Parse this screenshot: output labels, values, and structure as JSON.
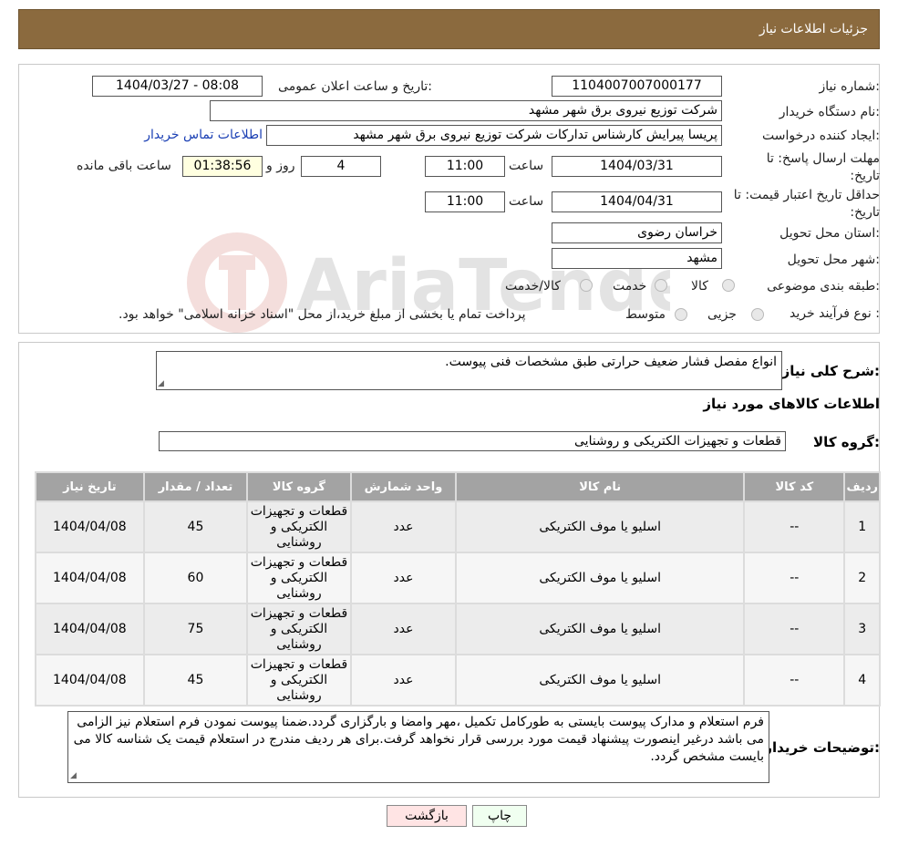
{
  "header": {
    "title": "جزئیات اطلاعات نیاز"
  },
  "form": {
    "need_number_label": "شماره نیاز:",
    "need_number": "1104007007000177",
    "announce_label": "تاریخ و ساعت اعلان عمومی:",
    "announce_value": "1404/03/27 - 08:08",
    "buyer_org_label": "نام دستگاه خریدار:",
    "buyer_org": "شرکت توزیع نیروی برق شهر مشهد",
    "requester_label": "ایجاد کننده درخواست:",
    "requester": "پریسا پیرایش کارشناس تدارکات شرکت توزیع نیروی برق شهر مشهد",
    "contact_link": "اطلاعات تماس خریدار",
    "deadline_label": "مهلت ارسال پاسخ: تا تاریخ:",
    "deadline_date": "1404/03/31",
    "time_label": "ساعت",
    "deadline_time": "11:00",
    "days_value": "4",
    "days_label": "روز و",
    "remaining_time": "01:38:56",
    "remaining_label": "ساعت باقی مانده",
    "validity_label": "حداقل تاریخ اعتبار قیمت: تا تاریخ:",
    "validity_date": "1404/04/31",
    "validity_time": "11:00",
    "province_label": "استان محل تحویل:",
    "province": "خراسان رضوی",
    "city_label": "شهر محل تحویل:",
    "city": "مشهد",
    "category_label": "طبقه بندی موضوعی:",
    "category_options": [
      "کالا",
      "خدمت",
      "کالا/خدمت"
    ],
    "process_label": "نوع فرآیند خرید :",
    "process_options": [
      "جزیی",
      "متوسط"
    ],
    "process_note": "پرداخت تمام یا بخشی از مبلغ خرید،از محل \"اسناد خزانه اسلامی\" خواهد بود."
  },
  "details": {
    "description_label": "شرح کلی نیاز:",
    "description": "انواع مفصل فشار ضعیف حرارتی طبق مشخصات فنی پیوست.",
    "goods_info_title": "اطلاعات کالاهای مورد نیاز",
    "goods_group_label": "گروه کالا:",
    "goods_group": "قطعات و تجهیزات الکتریکی و روشنایی",
    "table": {
      "headers": [
        "ردیف",
        "کد کالا",
        "نام کالا",
        "واحد شمارش",
        "گروه کالا",
        "تعداد / مقدار",
        "تاریخ نیاز"
      ],
      "rows": [
        [
          "1",
          "--",
          "اسلیو یا موف الکتریکی",
          "عدد",
          "قطعات و تجهیزات الکتریکی و روشنایی",
          "45",
          "1404/04/08"
        ],
        [
          "2",
          "--",
          "اسلیو یا موف الکتریکی",
          "عدد",
          "قطعات و تجهیزات الکتریکی و روشنایی",
          "60",
          "1404/04/08"
        ],
        [
          "3",
          "--",
          "اسلیو یا موف الکتریکی",
          "عدد",
          "قطعات و تجهیزات الکتریکی و روشنایی",
          "75",
          "1404/04/08"
        ],
        [
          "4",
          "--",
          "اسلیو یا موف الکتریکی",
          "عدد",
          "قطعات و تجهیزات الکتریکی و روشنایی",
          "45",
          "1404/04/08"
        ]
      ]
    },
    "buyer_notes_label": "توضیحات خریدار:",
    "buyer_notes": "فرم استعلام و مدارک پیوست بایستی به طورکامل تکمیل ،مهر وامضا و بارگزاری گردد.ضمنا پیوست نمودن فرم استعلام نیز الزامی می باشد درغیر اینصورت پیشنهاد قیمت مورد بررسی قرار نخواهد گرفت.برای هر ردیف مندرج در استعلام قیمت یک شناسه کالا می بایست مشخص گردد."
  },
  "buttons": {
    "print": "چاپ",
    "back": "بازگشت"
  },
  "watermark": {
    "text": "AriaTender.neT"
  },
  "colors": {
    "header": "#8b6a3e",
    "link": "#1a3fb4",
    "table_header": "#a3a3a3",
    "back_button": "#ffe4e4",
    "print_button": "#f0fff0"
  }
}
